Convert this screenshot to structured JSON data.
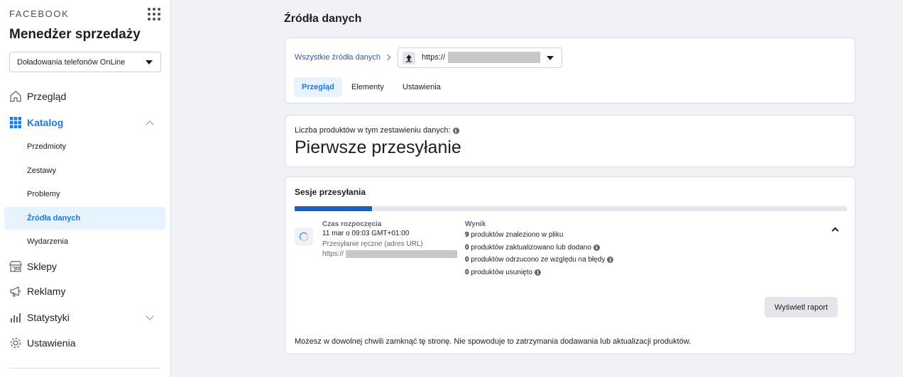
{
  "sidebar": {
    "brand": "FACEBOOK",
    "app_title": "Menedżer sprzedaży",
    "catalog_selector": "Doładowania telefonów OnLine",
    "nav": {
      "overview": "Przegląd",
      "catalog": "Katalog",
      "shops": "Sklepy",
      "ads": "Reklamy",
      "stats": "Statystyki",
      "settings": "Ustawienia"
    },
    "catalog_sub": [
      "Przedmioty",
      "Zestawy",
      "Problemy",
      "Źródła danych",
      "Wydarzenia"
    ]
  },
  "main": {
    "page_title": "Źródła danych",
    "breadcrumb": "Wszystkie źródła danych",
    "source_url_prefix": "https://",
    "tabs": [
      "Przegląd",
      "Elementy",
      "Ustawienia"
    ],
    "count_label": "Liczba produktów w tym zestawieniu danych:",
    "count_value": "Pierwsze przesyłanie",
    "sessions": {
      "title": "Sesje przesyłania",
      "progress": 0.14,
      "start_label": "Czas rozpoczęcia",
      "start_time": "11 mar o 09:03 GMT+01:00",
      "method": "Przesyłanie ręczne (adres URL)",
      "url_prefix": "https://",
      "result_label": "Wynik",
      "results": [
        {
          "count": "9",
          "text": " produktów znaleziono w pliku",
          "info": false
        },
        {
          "count": "0",
          "text": " produktów zaktualizowano lub dodano",
          "info": true
        },
        {
          "count": "0",
          "text": " produktów odrzucono ze względu na błędy",
          "info": true
        },
        {
          "count": "0",
          "text": " produktów usunięto",
          "info": true
        }
      ],
      "report_button": "Wyświetl raport",
      "footer_note": "Możesz w dowolnej chwili zamknąć tę stronę. Nie spowoduje to zatrzymania dodawania lub aktualizacji produktów."
    }
  },
  "colors": {
    "accent": "#1877f2",
    "progress": "#1861c7",
    "link": "#385898"
  }
}
